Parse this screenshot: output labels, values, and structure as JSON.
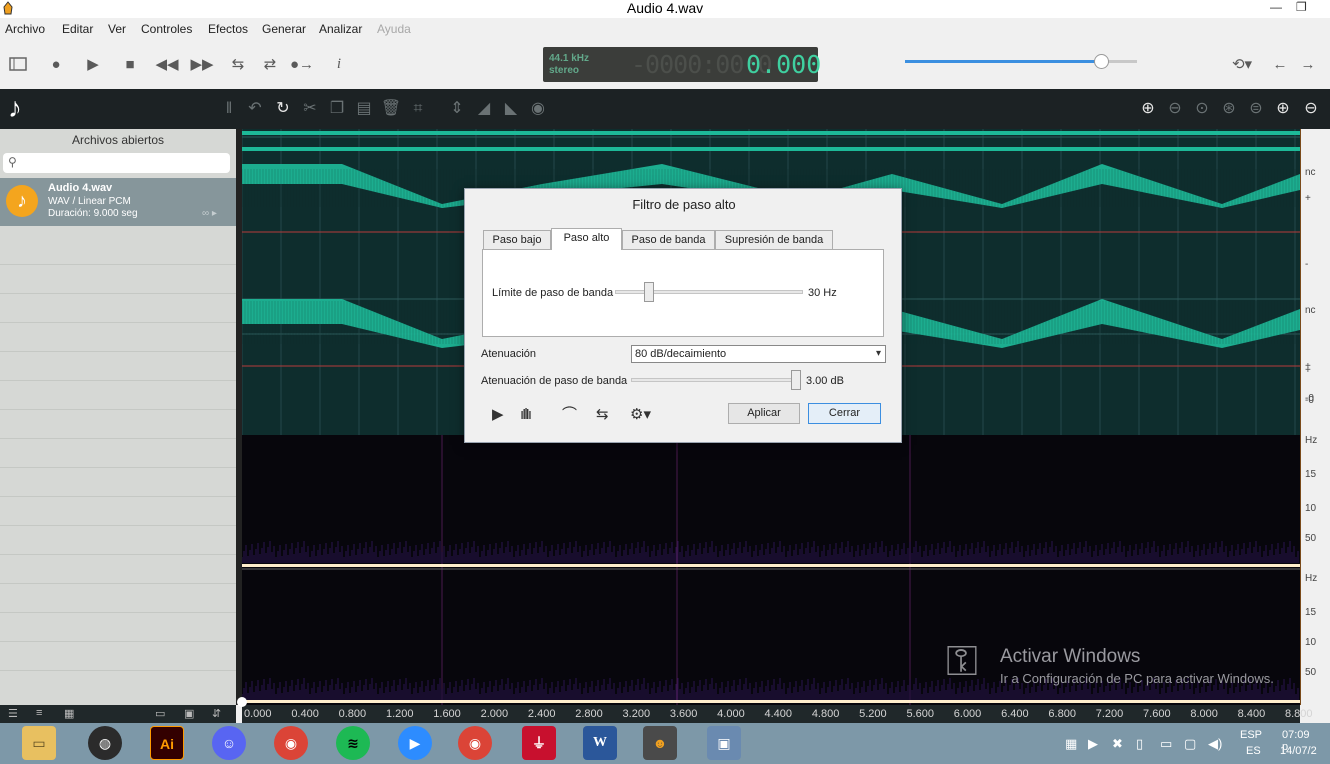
{
  "window": {
    "title": "Audio 4.wav"
  },
  "menu": [
    "Archivo",
    "Editar",
    "Ver",
    "Controles",
    "Efectos",
    "Generar",
    "Analizar",
    "Ayuda"
  ],
  "transport": {
    "buttons": [
      "view-toggle",
      "record",
      "play",
      "stop",
      "rewind",
      "fast-forward",
      "loop",
      "repeat",
      "skip",
      "info"
    ],
    "sample_rate": "44.1 kHz",
    "channels": "stereo",
    "time_dim": "-0000:00:0",
    "time_lit": "0.000",
    "volume_fraction": 0.85
  },
  "left_panel": {
    "title": "Archivos abiertos",
    "search_placeholder": "",
    "file": {
      "name": "Audio 4.wav",
      "type": "WAV / Linear PCM",
      "duration": "Duración: 9.000 seg"
    }
  },
  "ruler": [
    "0.000",
    "0.400",
    "0.800",
    "1.200",
    "1.600",
    "2.000",
    "2.400",
    "2.800",
    "3.200",
    "3.600",
    "4.000",
    "4.400",
    "4.800",
    "5.200",
    "5.600",
    "6.000",
    "6.400",
    "6.800",
    "7.200",
    "7.600",
    "8.000",
    "8.400",
    "8.800"
  ],
  "right_scale": [
    "nc",
    "+",
    "-",
    "-0",
    "nc",
    "+",
    "+",
    "-0",
    "Hz",
    "15",
    "10",
    "50",
    "Hz",
    "15",
    "10",
    "50"
  ],
  "dialog": {
    "title": "Filtro de paso alto",
    "tabs": [
      "Paso bajo",
      "Paso alto",
      "Paso de banda",
      "Supresión de banda"
    ],
    "selected_tab": 1,
    "cutoff_label": "Límite de paso de banda",
    "cutoff_value": "30 Hz",
    "cutoff_fraction": 0.15,
    "attenuation_label": "Atenuación",
    "attenuation_value": "80 dB/decaimiento",
    "pass_atten_label": "Atenuación de paso de banda",
    "pass_atten_value": "3.00 dB",
    "pass_atten_fraction": 0.98,
    "apply": "Aplicar",
    "close": "Cerrar"
  },
  "watermark": {
    "line1": "Activar Windows",
    "line2": "Ir a Configuración de PC para activar Windows."
  },
  "taskbar": {
    "apps": [
      "file-explorer",
      "obs",
      "illustrator",
      "discord",
      "chrome",
      "spotify",
      "zoom",
      "chrome-2",
      "acrobat",
      "word",
      "audio-app",
      "image-viewer"
    ],
    "illustrator_label": "Ai",
    "word_label": "W",
    "lang_top": "ESP",
    "lang_bottom": "ES",
    "time": "07:09 p",
    "date": "14/07/2"
  },
  "colors": {
    "waveform": "#1db998",
    "wave_bg": "#0e2d2d",
    "accent": "#3b8fe0",
    "lcd_text": "#3fd0a0"
  }
}
